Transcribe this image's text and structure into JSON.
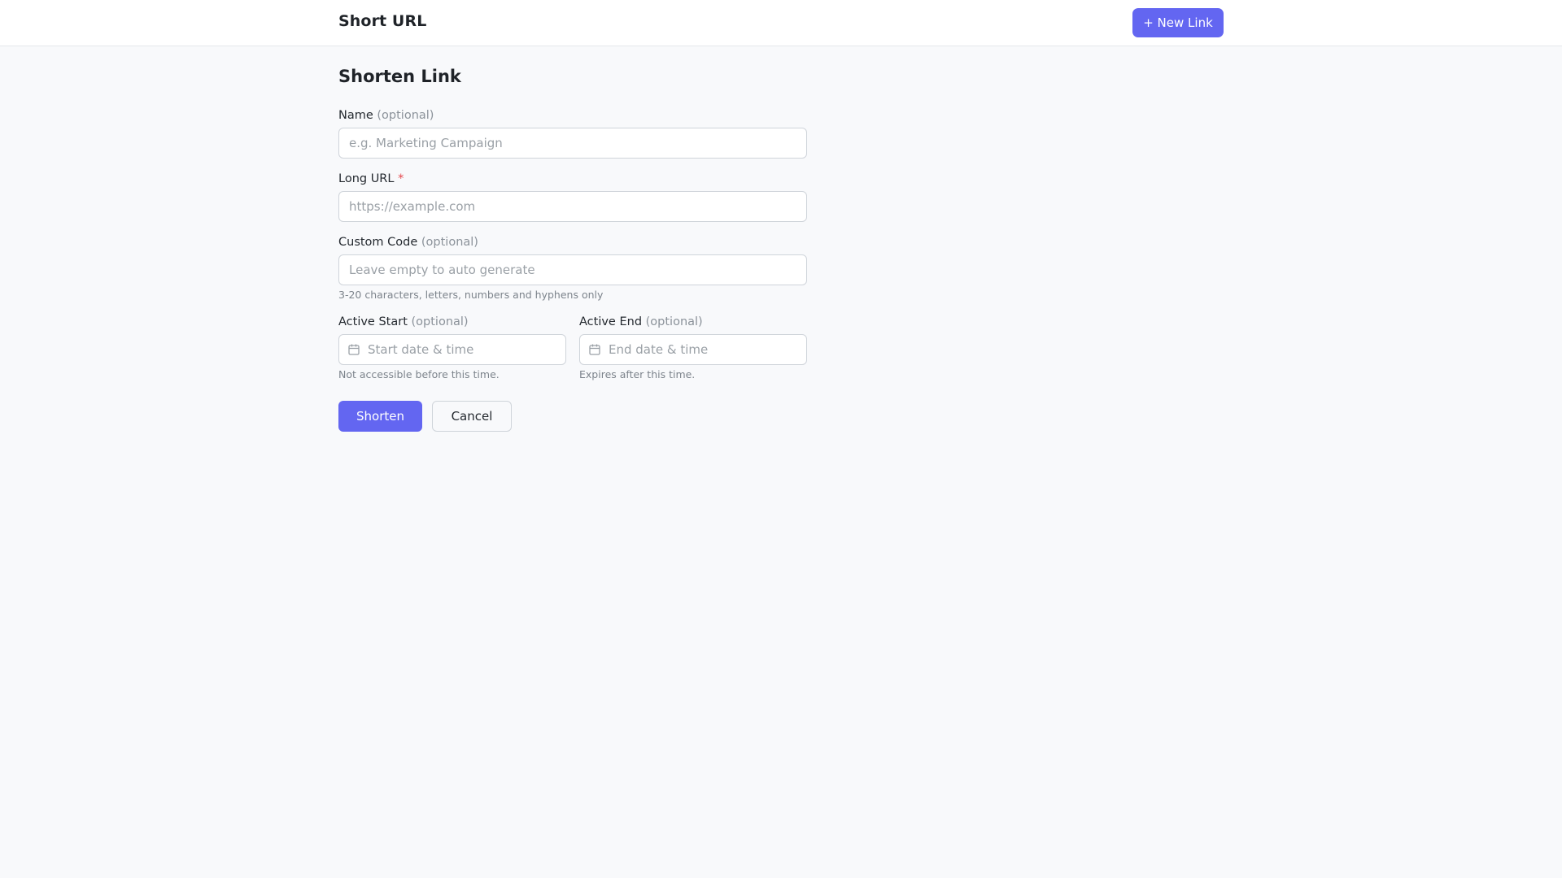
{
  "header": {
    "brand": "Short URL",
    "new_link_label": "+ New Link"
  },
  "form": {
    "title": "Shorten Link",
    "name": {
      "label": "Name",
      "optional": "(optional)",
      "placeholder": "e.g. Marketing Campaign",
      "value": ""
    },
    "long_url": {
      "label": "Long URL",
      "required_mark": "*",
      "placeholder": "https://example.com",
      "value": ""
    },
    "custom_code": {
      "label": "Custom Code",
      "optional": "(optional)",
      "placeholder": "Leave empty to auto generate",
      "value": "",
      "help": "3-20 characters, letters, numbers and hyphens only"
    },
    "active_start": {
      "label": "Active Start",
      "optional": "(optional)",
      "placeholder": "Start date & time",
      "value": "",
      "help": "Not accessible before this time.",
      "icon": "calendar-icon"
    },
    "active_end": {
      "label": "Active End",
      "optional": "(optional)",
      "placeholder": "End date & time",
      "value": "",
      "help": "Expires after this time.",
      "icon": "calendar-icon"
    },
    "submit_label": "Shorten",
    "cancel_label": "Cancel"
  },
  "colors": {
    "accent": "#6366f1",
    "required": "#e5484d",
    "background": "#f8f9fb"
  }
}
